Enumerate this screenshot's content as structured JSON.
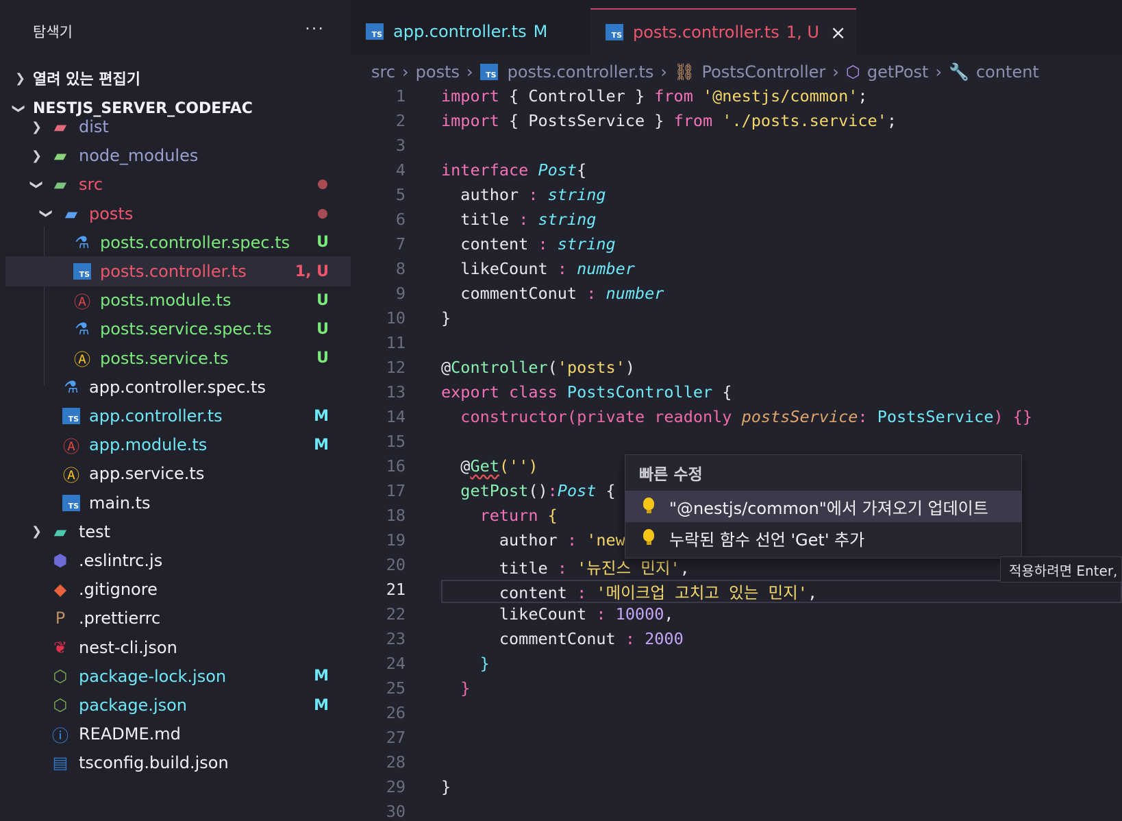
{
  "sidebar": {
    "title": "탐색기",
    "more": "···",
    "open_editors": "열려 있는 편집기",
    "project": "NESTJS_SERVER_CODEFAC",
    "items": [
      {
        "label": "dist",
        "badge": "",
        "color": "#9aa0d0"
      },
      {
        "label": "node_modules",
        "badge": "",
        "color": "#9aa0d0"
      },
      {
        "label": "src",
        "badge": "",
        "color": "#f0566b"
      },
      {
        "label": "posts",
        "badge": "",
        "color": "#f0566b"
      },
      {
        "label": "posts.controller.spec.ts",
        "badge": "U",
        "color": "#7bea7b"
      },
      {
        "label": "posts.controller.ts",
        "badge": "1, U",
        "color": "#f0566b"
      },
      {
        "label": "posts.module.ts",
        "badge": "U",
        "color": "#7bea7b"
      },
      {
        "label": "posts.service.spec.ts",
        "badge": "U",
        "color": "#7bea7b"
      },
      {
        "label": "posts.service.ts",
        "badge": "U",
        "color": "#7bea7b"
      },
      {
        "label": "app.controller.spec.ts",
        "badge": "",
        "color": "#f2f2f8"
      },
      {
        "label": "app.controller.ts",
        "badge": "M",
        "color": "#6ee7f7"
      },
      {
        "label": "app.module.ts",
        "badge": "M",
        "color": "#6ee7f7"
      },
      {
        "label": "app.service.ts",
        "badge": "",
        "color": "#f2f2f8"
      },
      {
        "label": "main.ts",
        "badge": "",
        "color": "#f2f2f8"
      },
      {
        "label": "test",
        "badge": "",
        "color": "#f2f2f8"
      },
      {
        "label": ".eslintrc.js",
        "badge": "",
        "color": "#f2f2f8"
      },
      {
        "label": ".gitignore",
        "badge": "",
        "color": "#f2f2f8"
      },
      {
        "label": ".prettierrc",
        "badge": "",
        "color": "#f2f2f8"
      },
      {
        "label": "nest-cli.json",
        "badge": "",
        "color": "#f2f2f8"
      },
      {
        "label": "package-lock.json",
        "badge": "M",
        "color": "#6ee7f7"
      },
      {
        "label": "package.json",
        "badge": "M",
        "color": "#6ee7f7"
      },
      {
        "label": "README.md",
        "badge": "",
        "color": "#f2f2f8"
      },
      {
        "label": "tsconfig.build.json",
        "badge": "",
        "color": "#f2f2f8"
      }
    ]
  },
  "tabs": [
    {
      "label": "app.controller.ts",
      "badge": "M"
    },
    {
      "label": "posts.controller.ts",
      "badge": "1, U",
      "close": "×"
    }
  ],
  "breadcrumb": [
    "src",
    "posts",
    "posts.controller.ts",
    "PostsController",
    "getPost",
    "content"
  ],
  "code": {
    "line_numbers": [
      "1",
      "2",
      "3",
      "4",
      "5",
      "6",
      "7",
      "8",
      "9",
      "10",
      "11",
      "12",
      "13",
      "14",
      "15",
      "16",
      "17",
      "18",
      "19",
      "20",
      "21",
      "22",
      "23",
      "24",
      "25",
      "26",
      "27",
      "28",
      "29",
      "30"
    ]
  },
  "quick_fix": {
    "title": "빠른 수정",
    "items": [
      "\"@nestjs/common\"에서 가져오기 업데이트",
      "누락된 함수 선언 'Get' 추가"
    ],
    "hint": "적용하려면 Enter,"
  }
}
